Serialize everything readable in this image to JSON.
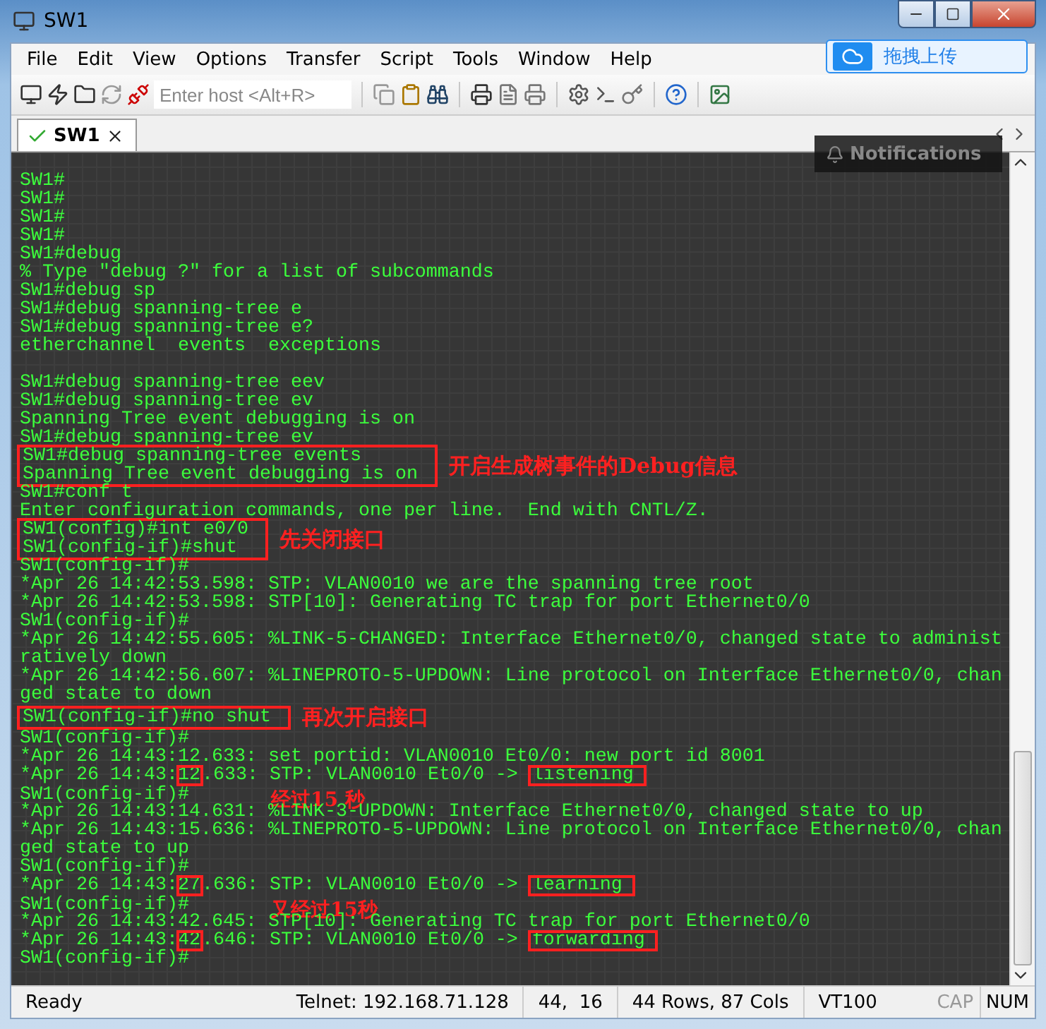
{
  "window": {
    "title": "SW1"
  },
  "menu": [
    "File",
    "Edit",
    "View",
    "Options",
    "Transfer",
    "Script",
    "Tools",
    "Window",
    "Help"
  ],
  "toolbar": {
    "host_field": {
      "placeholder": "Enter host <Alt+R>"
    }
  },
  "tabs": [
    {
      "label": "SW1",
      "selected": true,
      "connected": true
    }
  ],
  "upload_button": {
    "label": "拖拽上传"
  },
  "notifications": {
    "label": "Notifications"
  },
  "terminal": {
    "lines": [
      {
        "kind": "line",
        "text": "SW1#"
      },
      {
        "kind": "line",
        "text": "SW1#"
      },
      {
        "kind": "line",
        "text": "SW1#"
      },
      {
        "kind": "line",
        "text": "SW1#"
      },
      {
        "kind": "line",
        "text": "SW1#debug"
      },
      {
        "kind": "line",
        "text": "% Type \"debug ?\" for a list of subcommands"
      },
      {
        "kind": "line",
        "text": "SW1#debug sp"
      },
      {
        "kind": "line",
        "text": "SW1#debug spanning-tree e"
      },
      {
        "kind": "line",
        "text": "SW1#debug spanning-tree e?"
      },
      {
        "kind": "line",
        "text": "etherchannel  events  exceptions"
      },
      {
        "kind": "blank"
      },
      {
        "kind": "line",
        "text": "SW1#debug spanning-tree eev"
      },
      {
        "kind": "line",
        "text": "SW1#debug spanning-tree ev"
      },
      {
        "kind": "line",
        "text": "Spanning Tree event debugging is on"
      },
      {
        "kind": "line",
        "text": "SW1#debug spanning-tree ev"
      },
      {
        "kind": "group",
        "lines": [
          "SW1#debug spanning-tree events",
          "Spanning Tree event debugging is on"
        ],
        "note": "开启生成树事件的Debug信息"
      },
      {
        "kind": "line",
        "text": "SW1#conf t"
      },
      {
        "kind": "line",
        "text": "Enter configuration commands, one per line.  End with CNTL/Z."
      },
      {
        "kind": "group",
        "lines": [
          "SW1(config)#int e0/0",
          "SW1(config-if)#shut"
        ],
        "note": "先关闭接口"
      },
      {
        "kind": "line",
        "text": "SW1(config-if)#"
      },
      {
        "kind": "line",
        "text": "*Apr 26 14:42:53.598: STP: VLAN0010 we are the spanning tree root"
      },
      {
        "kind": "line",
        "text": "*Apr 26 14:42:53.598: STP[10]: Generating TC trap for port Ethernet0/0"
      },
      {
        "kind": "line",
        "text": "SW1(config-if)#"
      },
      {
        "kind": "line",
        "text": "*Apr 26 14:42:55.605: %LINK-5-CHANGED: Interface Ethernet0/0, changed state to administ"
      },
      {
        "kind": "line",
        "text": "ratively down"
      },
      {
        "kind": "line",
        "text": "*Apr 26 14:42:56.607: %LINEPROTO-5-UPDOWN: Line protocol on Interface Ethernet0/0, chan"
      },
      {
        "kind": "line",
        "text": "ged state to down"
      },
      {
        "kind": "group",
        "lines": [
          "SW1(config-if)#no shut"
        ],
        "note": "再次开启接口"
      },
      {
        "kind": "line",
        "text": "SW1(config-if)#"
      },
      {
        "kind": "line",
        "text": "*Apr 26 14:43:12.633: set portid: VLAN0010 Et0/0: new port id 8001"
      },
      {
        "kind": "split",
        "parts": [
          {
            "text": "*Apr 26 14:43:",
            "boxed": false
          },
          {
            "text": "12",
            "boxed": true
          },
          {
            "text": ".633: STP: VLAN0010 Et0/0 -> ",
            "boxed": false
          },
          {
            "text": "listening",
            "boxed": true
          }
        ]
      },
      {
        "kind": "line",
        "text": "SW1(config-if)#",
        "overlay_note": "经过15 秒"
      },
      {
        "kind": "line",
        "text": "*Apr 26 14:43:14.631: %LINK-3-UPDOWN: Interface Ethernet0/0, changed state to up"
      },
      {
        "kind": "line",
        "text": "*Apr 26 14:43:15.636: %LINEPROTO-5-UPDOWN: Line protocol on Interface Ethernet0/0, chan"
      },
      {
        "kind": "line",
        "text": "ged state to up"
      },
      {
        "kind": "line",
        "text": "SW1(config-if)#"
      },
      {
        "kind": "split",
        "parts": [
          {
            "text": "*Apr 26 14:43:",
            "boxed": false
          },
          {
            "text": "27",
            "boxed": true
          },
          {
            "text": ".636: STP: VLAN0010 Et0/0 -> ",
            "boxed": false
          },
          {
            "text": "learning",
            "boxed": true
          }
        ]
      },
      {
        "kind": "line",
        "text": "SW1(config-if)#",
        "overlay_note": "又经过15秒"
      },
      {
        "kind": "line",
        "text": "*Apr 26 14:43:42.645: STP[10]: Generating TC trap for port Ethernet0/0"
      },
      {
        "kind": "split",
        "parts": [
          {
            "text": "*Apr 26 14:43:",
            "boxed": false
          },
          {
            "text": "42",
            "boxed": true
          },
          {
            "text": ".646: STP: VLAN0010 Et0/0 -> ",
            "boxed": false
          },
          {
            "text": "forwarding",
            "boxed": true
          }
        ]
      },
      {
        "kind": "line",
        "text": "SW1(config-if)#"
      }
    ]
  },
  "status_bar": {
    "message": "Ready",
    "connection": "Telnet: 192.168.71.128",
    "cursor": "44,  16",
    "size": "44 Rows, 87 Cols",
    "emulation": "VT100",
    "indicators": [
      {
        "label": "CAP",
        "on": false
      },
      {
        "label": "NUM",
        "on": true
      }
    ]
  }
}
